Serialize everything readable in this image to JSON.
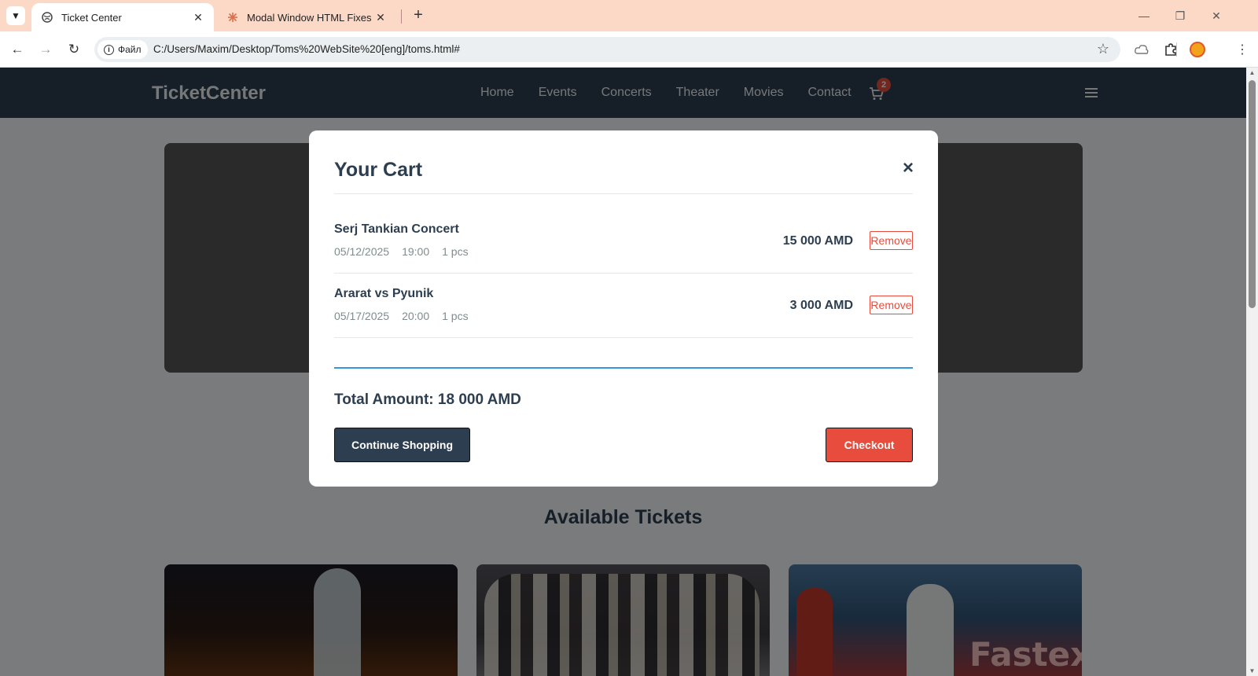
{
  "browser": {
    "tabs": [
      {
        "title": "Ticket Center",
        "active": true
      },
      {
        "title": "Modal Window HTML Fixes - Cl",
        "active": false
      }
    ],
    "site_info_label": "Файл",
    "url": "C:/Users/Maxim/Desktop/Toms%20WebSite%20[eng]/toms.html#",
    "accent_color": "#fbd9c6"
  },
  "header": {
    "logo": "TicketCenter",
    "nav": [
      "Home",
      "Events",
      "Concerts",
      "Theater",
      "Movies",
      "Contact"
    ],
    "cart_count": "2",
    "bg_color": "#2c3e50"
  },
  "page": {
    "section_title": "Available Tickets"
  },
  "modal": {
    "title": "Your Cart",
    "close_icon": "×",
    "items": [
      {
        "name": "Serj Tankian Concert",
        "date": "05/12/2025",
        "time": "19:00",
        "qty": "1 pcs",
        "price": "15 000 AMD",
        "remove_label": "Remove"
      },
      {
        "name": "Ararat vs Pyunik",
        "date": "05/17/2025",
        "time": "20:00",
        "qty": "1 pcs",
        "price": "3 000 AMD",
        "remove_label": "Remove"
      }
    ],
    "total_label": "Total Amount: 18 000 AMD",
    "continue_label": "Continue Shopping",
    "checkout_label": "Checkout",
    "colors": {
      "primary": "#2c3e50",
      "danger": "#e74c3c",
      "accent": "#3498db"
    }
  }
}
